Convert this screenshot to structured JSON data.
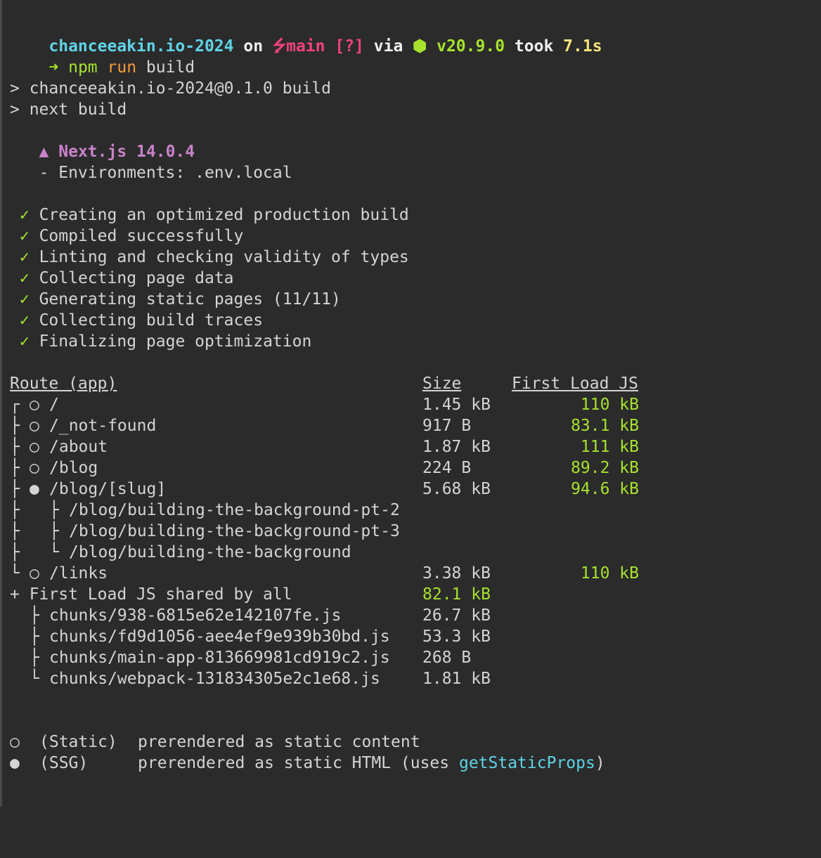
{
  "prompt": {
    "dir": "chanceeakin.io-2024",
    "on": "on",
    "branch_icon": "git-branch-icon",
    "branch": "main",
    "status": "[?]",
    "via": "via",
    "node_icon": "node-hexagon-icon",
    "node_version": "v20.9.0",
    "took": "took",
    "duration": "7.1s",
    "arrow": "➜",
    "cmd_npm": "npm",
    "cmd_run": "run",
    "cmd_arg": "build"
  },
  "script_echo": [
    "> chanceeakin.io-2024@0.1.0 build",
    "> next build"
  ],
  "next": {
    "logo": "▲",
    "title": "Next.js 14.0.4",
    "env_line": "- Environments: .env.local"
  },
  "steps": {
    "mark": "✓",
    "items": [
      "Creating an optimized production build",
      "Compiled successfully",
      "Linting and checking validity of types",
      "Collecting page data",
      "Generating static pages (11/11)",
      "Collecting build traces",
      "Finalizing page optimization"
    ]
  },
  "table": {
    "headers": {
      "route": "Route (app)",
      "size": "Size",
      "first_load": "First Load JS"
    },
    "rows": [
      {
        "tree": "┌",
        "marker": "○",
        "path": "/",
        "size": "1.45 kB",
        "first_load": "110 kB"
      },
      {
        "tree": "├",
        "marker": "○",
        "path": "/_not-found",
        "size": "917 B",
        "first_load": "83.1 kB"
      },
      {
        "tree": "├",
        "marker": "○",
        "path": "/about",
        "size": "1.87 kB",
        "first_load": "111 kB"
      },
      {
        "tree": "├",
        "marker": "○",
        "path": "/blog",
        "size": "224 B",
        "first_load": "89.2 kB"
      },
      {
        "tree": "├",
        "marker": "●",
        "path": "/blog/[slug]",
        "size": "5.68 kB",
        "first_load": "94.6 kB"
      },
      {
        "tree": "├",
        "marker": "├",
        "path": "/blog/building-the-background-pt-2",
        "size": "",
        "first_load": ""
      },
      {
        "tree": "├",
        "marker": "├",
        "path": "/blog/building-the-background-pt-3",
        "size": "",
        "first_load": ""
      },
      {
        "tree": "├",
        "marker": "└",
        "path": "/blog/building-the-background",
        "size": "",
        "first_load": ""
      },
      {
        "tree": "└",
        "marker": "○",
        "path": "/links",
        "size": "3.38 kB",
        "first_load": "110 kB"
      }
    ],
    "shared": {
      "label": "+ First Load JS shared by all",
      "size": "82.1 kB",
      "chunks": [
        {
          "tree": "├",
          "name": "chunks/938-6815e62e142107fe.js",
          "size": "26.7 kB"
        },
        {
          "tree": "├",
          "name": "chunks/fd9d1056-aee4ef9e939b30bd.js",
          "size": "53.3 kB"
        },
        {
          "tree": "├",
          "name": "chunks/main-app-813669981cd919c2.js",
          "size": "268 B"
        },
        {
          "tree": "└",
          "name": "chunks/webpack-131834305e2c1e68.js",
          "size": "1.81 kB"
        }
      ]
    }
  },
  "legend": [
    {
      "marker": "○",
      "kind": "(Static)",
      "desc": "prerendered as static content",
      "extra": "",
      "tail": ""
    },
    {
      "marker": "●",
      "kind": "(SSG)",
      "desc": "prerendered as static HTML (uses ",
      "extra": "getStaticProps",
      "tail": ")"
    }
  ],
  "colors": {
    "background": "#2b2b2b",
    "text": "#d4d4d4",
    "cyan": "#5fd3e6",
    "pink": "#f0437a",
    "lime": "#a6e22e",
    "yellow": "#f5e27a",
    "orange": "#f39c3a",
    "violet": "#c982c9"
  }
}
